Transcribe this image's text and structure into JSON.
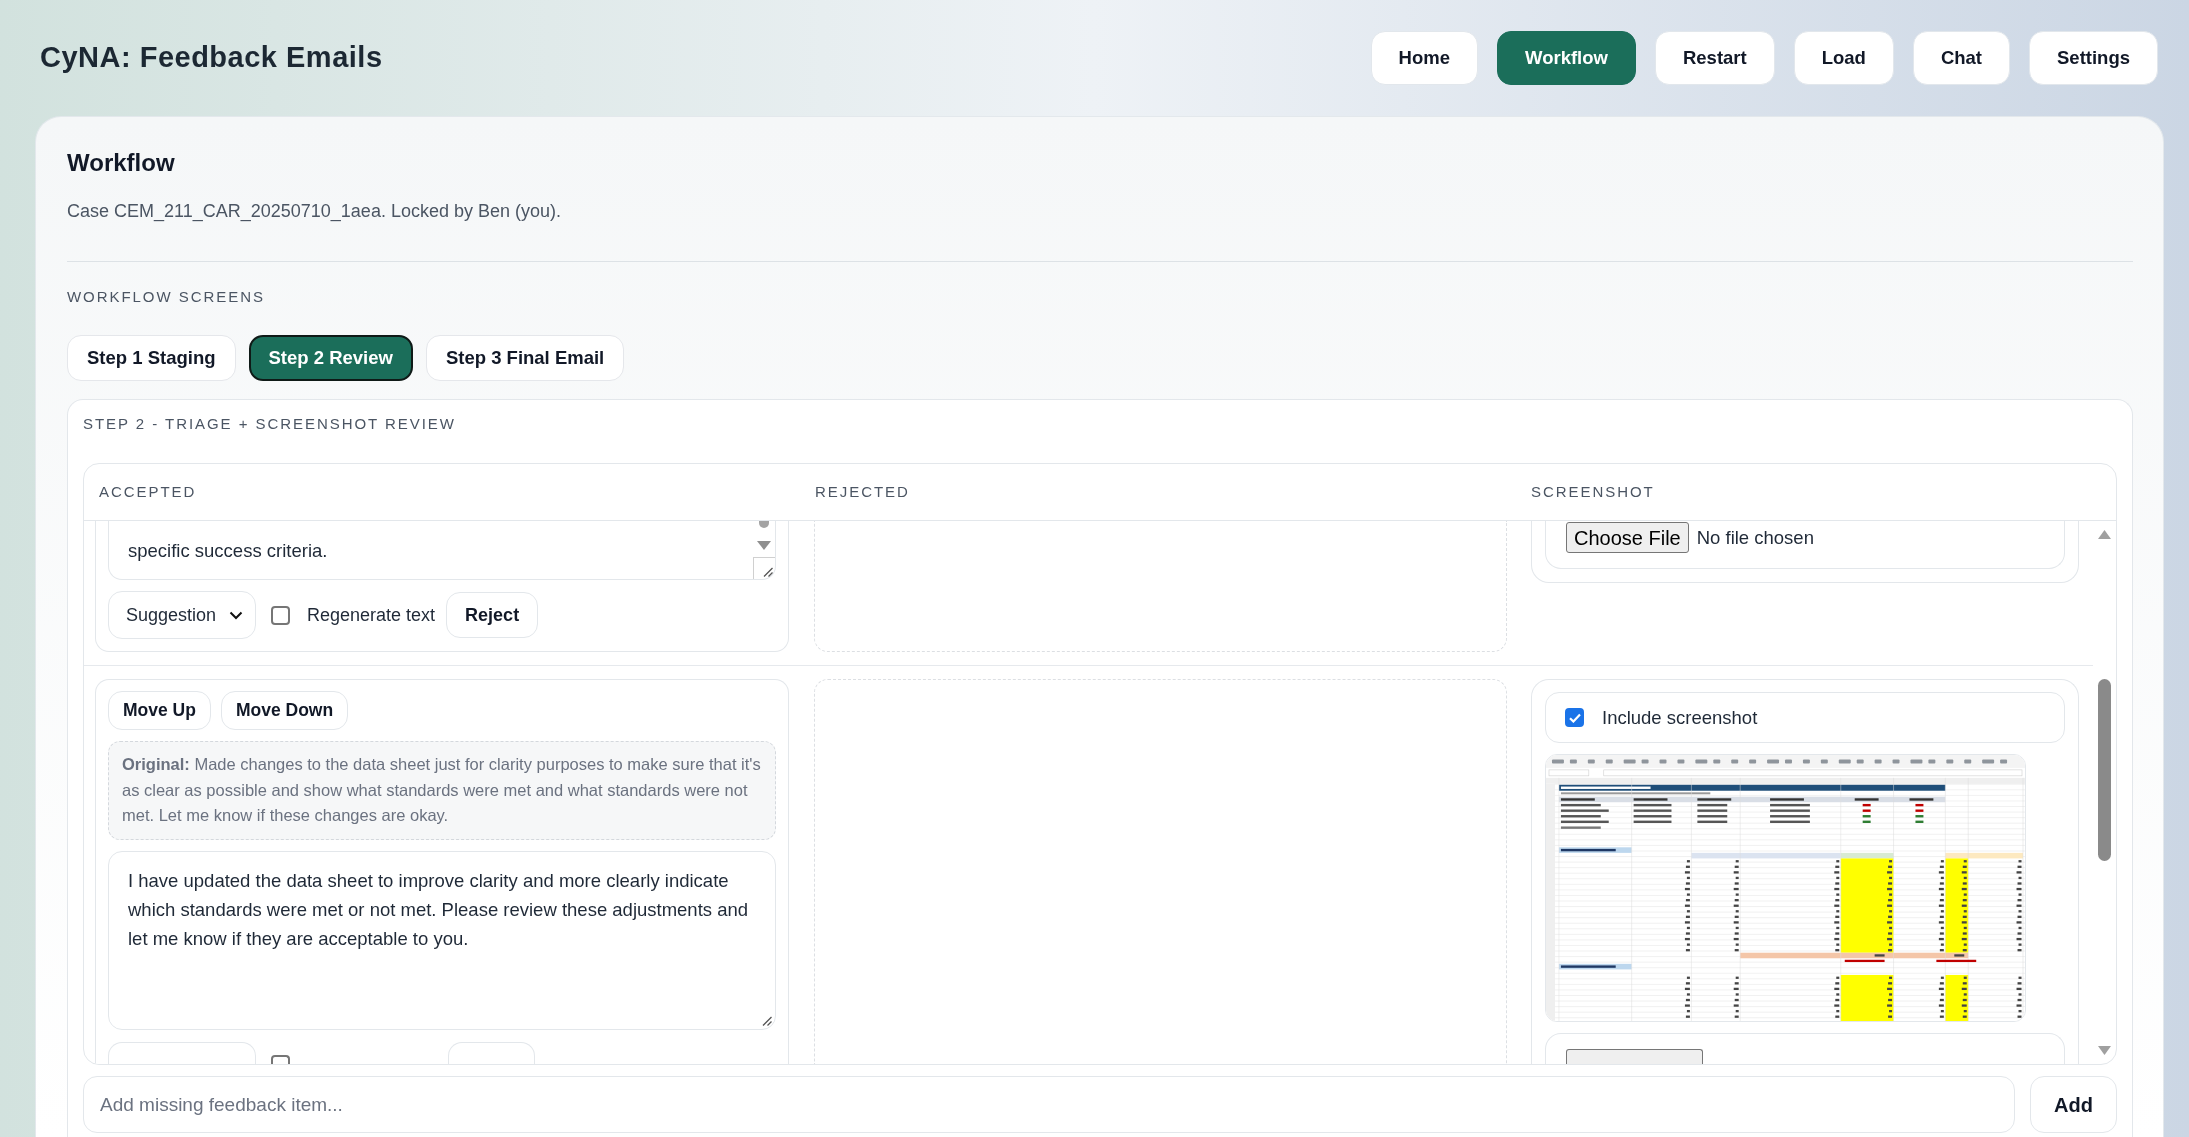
{
  "app": {
    "title": "CyNA: Feedback Emails"
  },
  "nav": [
    {
      "label": "Home",
      "selected": false
    },
    {
      "label": "Workflow",
      "selected": true
    },
    {
      "label": "Restart",
      "selected": false
    },
    {
      "label": "Load",
      "selected": false
    },
    {
      "label": "Chat",
      "selected": false
    },
    {
      "label": "Settings",
      "selected": false
    }
  ],
  "workflow": {
    "title": "Workflow",
    "case_info": "Case CEM_211_CAR_20250710_1aea. Locked by Ben (you).",
    "screens_label": "WORKFLOW SCREENS",
    "tabs": [
      {
        "label": "Step 1 Staging",
        "selected": false
      },
      {
        "label": "Step 2 Review",
        "selected": true
      },
      {
        "label": "Step 3 Final Email",
        "selected": false
      }
    ]
  },
  "review": {
    "title": "STEP 2 - TRIAGE + SCREENSHOT REVIEW",
    "columns": [
      "ACCEPTED",
      "REJECTED",
      "SCREENSHOT"
    ],
    "rows": [
      {
        "accepted": {
          "text": "specific success criteria.",
          "category": "Suggestion",
          "regenerate": false,
          "regenerate_label": "Regenerate text",
          "reject": "Reject"
        },
        "screenshot": [
          {
            "kind": "file",
            "button": "Choose File",
            "status": "No file chosen"
          }
        ]
      },
      {
        "accepted": {
          "move_up": "Move Up",
          "move_down": "Move Down",
          "original": "**Original:** Made changes to the data sheet just for clarity purposes to make sure that it's as clear as possible and show what standards were met and what standards were not met. Let me know if these changes are okay.",
          "text": "I have updated the data sheet to improve clarity and more clearly indicate which standards were met or not met. Please review these adjustments and let me know if they are acceptable to you.",
          "regenerate": false
        },
        "screenshot": [
          {
            "kind": "include",
            "label": "Include screenshot",
            "checked": true
          },
          {
            "kind": "image"
          },
          {
            "kind": "file"
          }
        ]
      }
    ]
  },
  "add_item": {
    "placeholder": "Add missing feedback item...",
    "button": "Add"
  }
}
